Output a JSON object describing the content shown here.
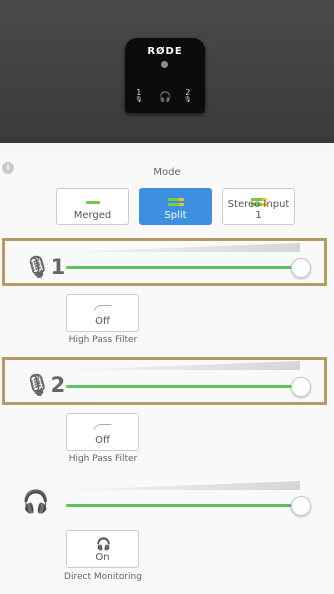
{
  "device": {
    "brand": "RØDE",
    "port1": "1",
    "port2": "2"
  },
  "mode": {
    "label": "Mode",
    "options": [
      {
        "label": "Merged",
        "active": false
      },
      {
        "label": "Split",
        "active": true
      },
      {
        "label": "Stereo Input 1",
        "active": false
      }
    ]
  },
  "channels": [
    {
      "number": "1",
      "level": 1.0,
      "filter_state": "Off",
      "filter_label": "High Pass Filter"
    },
    {
      "number": "2",
      "level": 1.0,
      "filter_state": "Off",
      "filter_label": "High Pass Filter"
    }
  ],
  "headphones": {
    "level": 1.0,
    "monitor_state": "On",
    "monitor_label": "Direct Monitoring"
  },
  "colors": {
    "accent": "#3d8fe0",
    "slider_fill": "#5ec25b",
    "highlight_frame": "#b89b63"
  }
}
